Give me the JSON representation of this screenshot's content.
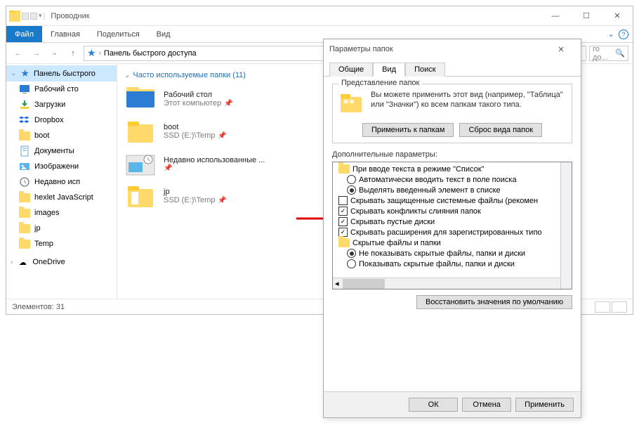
{
  "explorer": {
    "title": "Проводник",
    "ribbon": {
      "file": "Файл",
      "home": "Главная",
      "share": "Поделиться",
      "view": "Вид"
    },
    "address": "Панель быстрого доступа",
    "searchPlaceholder": "го до...",
    "nav": {
      "quick": "Панель быстрого",
      "items": [
        "Рабочий сто",
        "Загрузки",
        "Dropbox",
        "boot",
        "Документы",
        "Изображени",
        "Недавно исп",
        "hexlet JavaScript",
        "images",
        "jp",
        "Temp",
        "OneDrive"
      ]
    },
    "main": {
      "heading": "Часто используемые папки (11)",
      "items": [
        {
          "name": "Рабочий стол",
          "sub": "Этот компьютер"
        },
        {
          "name": "boot",
          "sub": "SSD (E:)\\Temp"
        },
        {
          "name": "Недавно использованные ...",
          "sub": ""
        },
        {
          "name": "jp",
          "sub": "SSD (E:)\\Temp"
        }
      ]
    },
    "status": "Элементов: 31"
  },
  "dialog": {
    "title": "Параметры папок",
    "tabs": {
      "general": "Общие",
      "view": "Вид",
      "search": "Поиск"
    },
    "group": {
      "legend": "Представление папок",
      "text": "Вы можете применить этот вид (например, \"Таблица\" или \"Значки\") ко всем папкам такого типа.",
      "apply": "Применить к папкам",
      "reset": "Сброс вида папок"
    },
    "advLabel": "Дополнительные параметры:",
    "tree": {
      "g1": "При вводе текста в режиме \"Список\"",
      "r1": "Автоматически вводить текст в поле поиска",
      "r2": "Выделять введенный элемент в списке",
      "c1": "Скрывать защищенные системные файлы (рекомен",
      "c2": "Скрывать конфликты слияния папок",
      "c3": "Скрывать пустые диски",
      "c4": "Скрывать расширения для зарегистрированных типо",
      "g2": "Скрытые файлы и папки",
      "r3": "Не показывать скрытые файлы, папки и диски",
      "r4": "Показывать скрытые файлы, папки и диски"
    },
    "restore": "Восстановить значения по умолчанию",
    "ok": "ОК",
    "cancel": "Отмена",
    "applyBtn": "Применить"
  }
}
